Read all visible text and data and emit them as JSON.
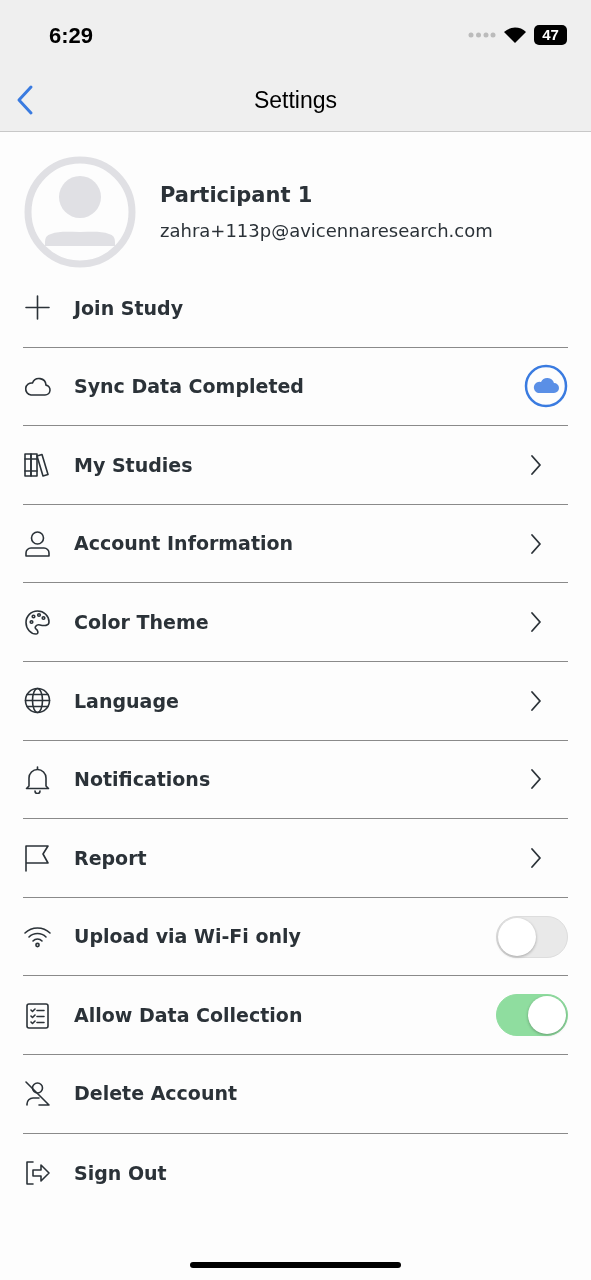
{
  "status_bar": {
    "time": "6:29",
    "battery": "47"
  },
  "nav": {
    "title": "Settings"
  },
  "profile": {
    "name": "Participant 1",
    "email": "zahra+113p@avicennaresearch.com"
  },
  "rows": [
    {
      "kind": "plain",
      "label": "Join Study"
    },
    {
      "kind": "status",
      "label": "Sync Data Completed"
    },
    {
      "kind": "link",
      "label": "My Studies"
    },
    {
      "kind": "link",
      "label": "Account Information"
    },
    {
      "kind": "link",
      "label": "Color Theme"
    },
    {
      "kind": "link",
      "label": "Language"
    },
    {
      "kind": "link",
      "label": "Notifications"
    },
    {
      "kind": "link",
      "label": "Report"
    },
    {
      "kind": "toggle",
      "label": "Upload via Wi-Fi only",
      "on": false
    },
    {
      "kind": "toggle",
      "label": "Allow Data Collection",
      "on": true
    },
    {
      "kind": "plain",
      "label": "Delete Account"
    },
    {
      "kind": "plain",
      "label": "Sign Out"
    }
  ]
}
